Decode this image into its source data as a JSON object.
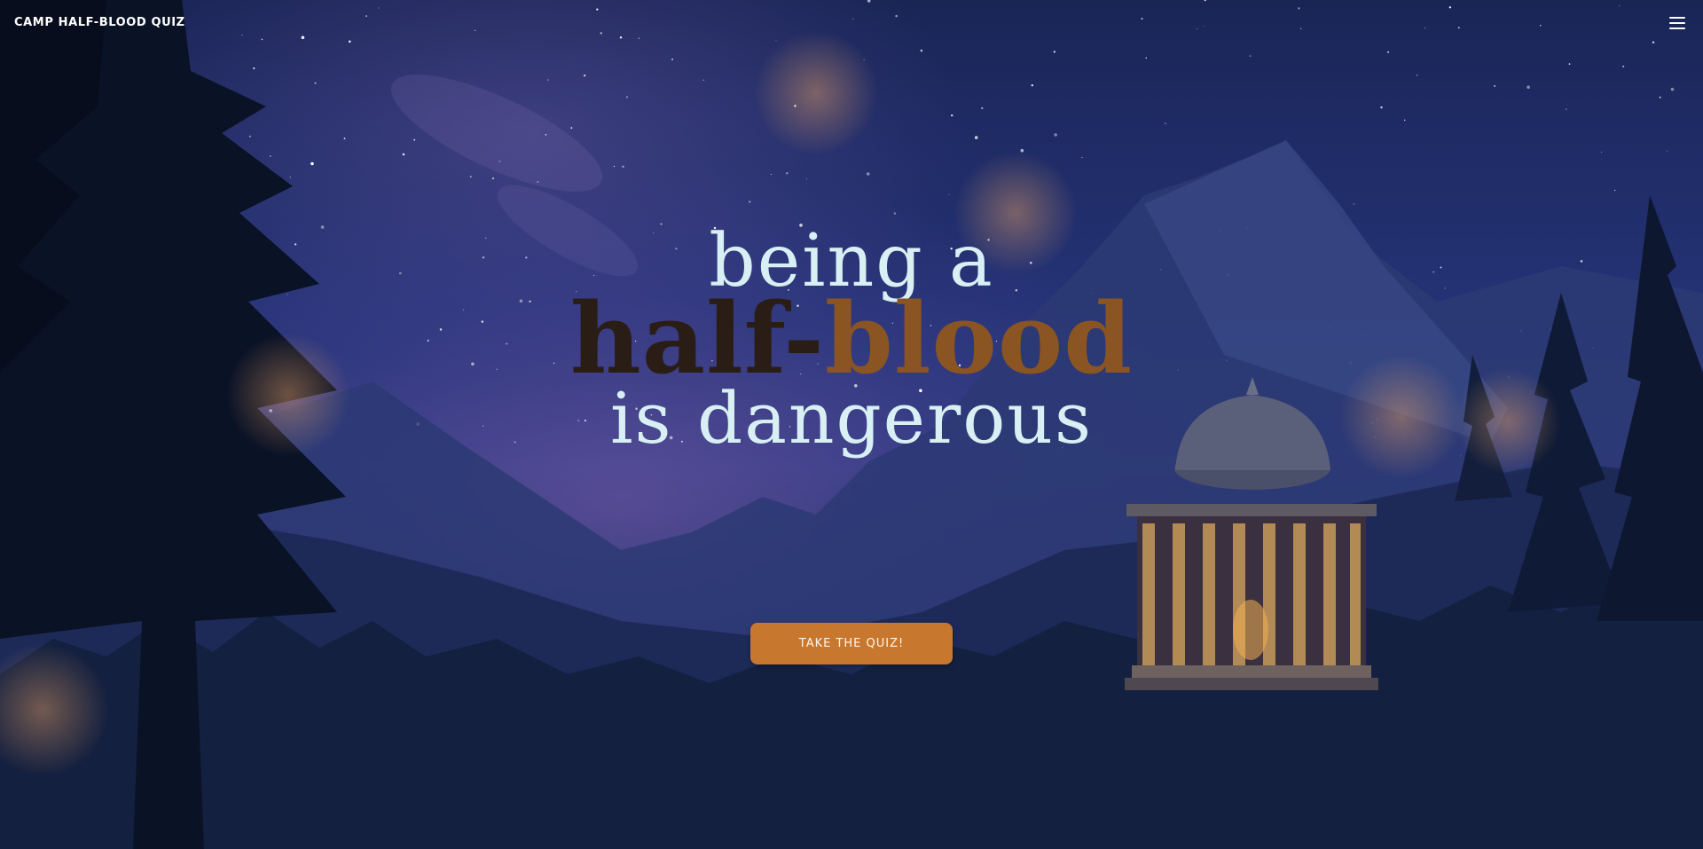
{
  "header": {
    "logo_text": "CAMP HALF-BLOOD QUIZ",
    "menu_icon": "hamburger-menu-icon"
  },
  "hero": {
    "line_1": "being a",
    "line_2_part_1": "half-",
    "line_2_part_2": "blood",
    "line_3": "is dangerous"
  },
  "cta": {
    "label": "TAKE THE QUIZ!"
  },
  "colors": {
    "sky_top": "#1a2556",
    "sky_mid": "#2e3b80",
    "title_light": "#d8f0f4",
    "title_dark": "#2a1d15",
    "title_accent": "#8a5423",
    "button": "#c8772f"
  }
}
